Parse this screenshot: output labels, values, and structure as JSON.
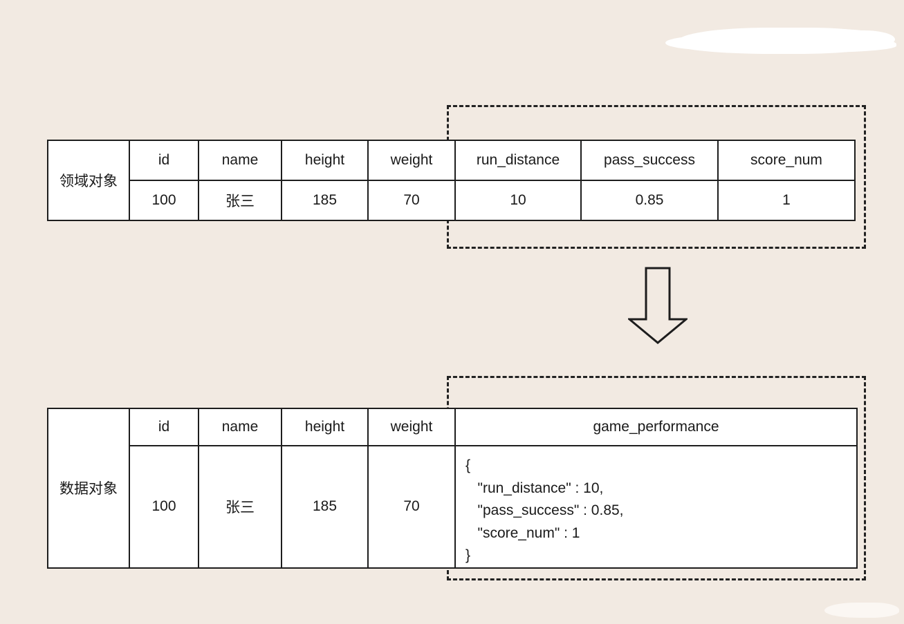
{
  "background_color": "#f2eae2",
  "line_color": "#1d1d1d",
  "diagram": {
    "title_hidden": true,
    "domain_table": {
      "row_label": "领域对象",
      "headers": [
        "id",
        "name",
        "height",
        "weight",
        "run_distance",
        "pass_success",
        "score_num"
      ],
      "values": [
        "100",
        "张三",
        "185",
        "70",
        "10",
        "0.85",
        "1"
      ],
      "highlight_columns": [
        "run_distance",
        "pass_success",
        "score_num"
      ]
    },
    "data_table": {
      "row_label": "数据对象",
      "headers": [
        "id",
        "name",
        "height",
        "weight",
        "game_performance"
      ],
      "values": [
        "100",
        "张三",
        "185",
        "70"
      ],
      "json_value": "{\n   \"run_distance\" : 10,\n   \"pass_success\" : 0.85,\n   \"score_num\" : 1\n}",
      "highlight_columns": [
        "game_performance"
      ]
    },
    "arrow": {
      "direction": "down",
      "style": "hollow-block-arrow"
    },
    "annotations": [
      {
        "name": "top-redaction-mark",
        "kind": "white-brush-stroke"
      },
      {
        "name": "bottom-redaction-mark",
        "kind": "white-brush-stroke"
      }
    ]
  }
}
